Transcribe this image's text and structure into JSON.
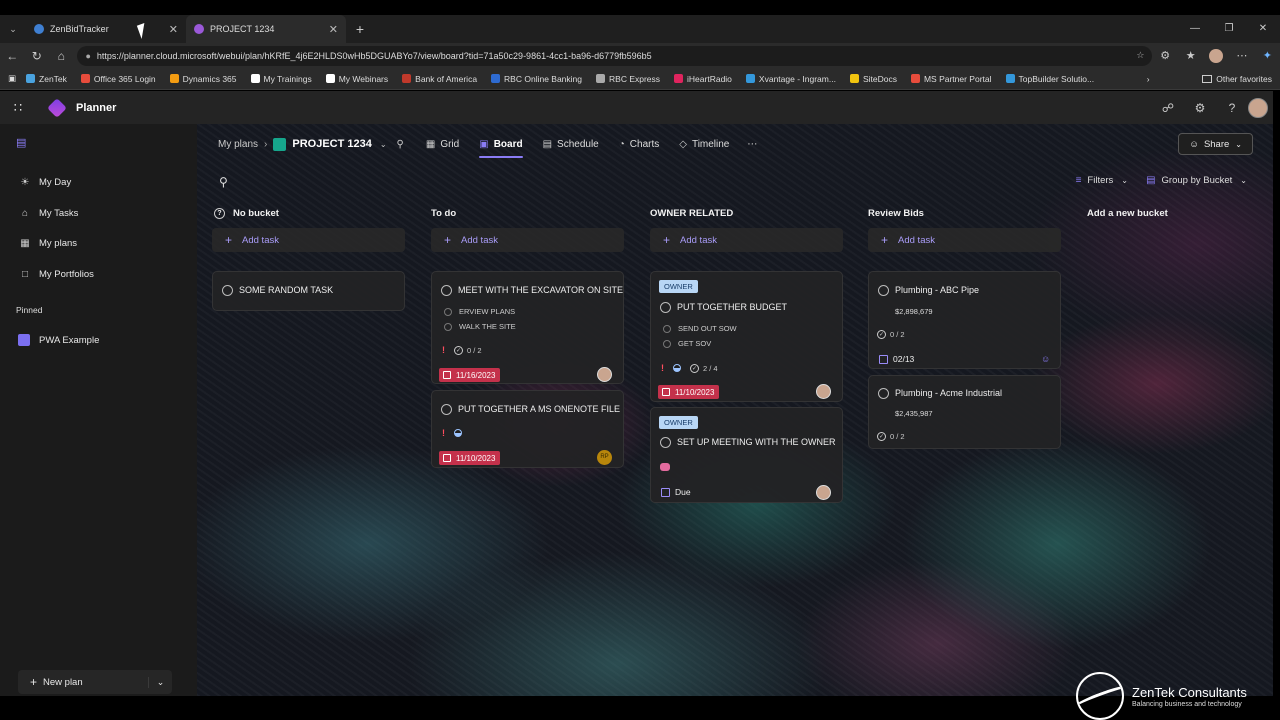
{
  "browser": {
    "tabs": [
      {
        "label": "ZenBidTracker",
        "active": false
      },
      {
        "label": "PROJECT 1234",
        "active": true
      }
    ],
    "url": "https://planner.cloud.microsoft/webui/plan/hKRfE_4j6E2HLDS0wHb5DGUABYo7/view/board?tid=71a50c29-9861-4cc1-ba96-d6779fb596b5",
    "favorites": [
      {
        "label": "ZenTek",
        "color": "#4aa3df"
      },
      {
        "label": "Office 365 Login",
        "color": "#e74c3c"
      },
      {
        "label": "Dynamics 365",
        "color": "#f39c12"
      },
      {
        "label": "My Trainings",
        "color": "#ffffff"
      },
      {
        "label": "My Webinars",
        "color": "#ffffff"
      },
      {
        "label": "Bank of America",
        "color": "#c0392b"
      },
      {
        "label": "RBC Online Banking",
        "color": "#2e6bd1"
      },
      {
        "label": "RBC Express",
        "color": "#aaaaaa"
      },
      {
        "label": "iHeartRadio",
        "color": "#e0245e"
      },
      {
        "label": "Xvantage - Ingram...",
        "color": "#3498db"
      },
      {
        "label": "SiteDocs",
        "color": "#f1c40f"
      },
      {
        "label": "MS Partner Portal",
        "color": "#e74c3c"
      },
      {
        "label": "TopBuilder Solutio...",
        "color": "#3498db"
      }
    ],
    "other_favorites": "Other favorites"
  },
  "app": {
    "title": "Planner"
  },
  "leftnav": {
    "items": [
      "My Day",
      "My Tasks",
      "My plans",
      "My Portfolios"
    ],
    "pinned_heading": "Pinned",
    "pinned": [
      "PWA Example"
    ],
    "new_plan": "New plan"
  },
  "board": {
    "breadcrumb_root": "My plans",
    "plan_name": "PROJECT 1234",
    "views": [
      "Grid",
      "Board",
      "Schedule",
      "Charts",
      "Timeline"
    ],
    "selected_view": "Board",
    "share": "Share",
    "filters": "Filters",
    "group_by": "Group by Bucket",
    "add_task": "Add task",
    "add_bucket": "Add a new bucket",
    "buckets": [
      {
        "name": "No bucket"
      },
      {
        "name": "To do"
      },
      {
        "name": "OWNER RELATED"
      },
      {
        "name": "Review Bids"
      }
    ],
    "cards": {
      "random": {
        "title": "SOME RANDOM TASK"
      },
      "excavator": {
        "title": "MEET WITH THE EXCAVATOR ON SITE",
        "checklist": [
          "ERVIEW PLANS",
          "WALK THE SITE"
        ],
        "progress": "0 / 2",
        "date": "11/16/2023"
      },
      "onenote": {
        "title": "PUT TOGETHER A MS ONENOTE FILE",
        "date": "11/10/2023",
        "avatar": "RP"
      },
      "budget": {
        "label": "OWNER",
        "title": "PUT TOGETHER BUDGET",
        "checklist": [
          "SEND OUT SOW",
          "GET SOV"
        ],
        "progress": "2 / 4",
        "date": "11/10/2023"
      },
      "meeting": {
        "label": "OWNER",
        "title": "SET UP MEETING WITH THE OWNER",
        "due": "Due"
      },
      "abc": {
        "title": "Plumbing - ABC Pipe",
        "amount": "$2,898,679",
        "progress": "0 / 2",
        "date": "02/13"
      },
      "acme": {
        "title": "Plumbing - Acme Industrial",
        "amount": "$2,435,987",
        "progress": "0 / 2"
      }
    }
  },
  "watermark": {
    "name": "ZenTek Consultants",
    "tagline": "Balancing business and technology"
  }
}
